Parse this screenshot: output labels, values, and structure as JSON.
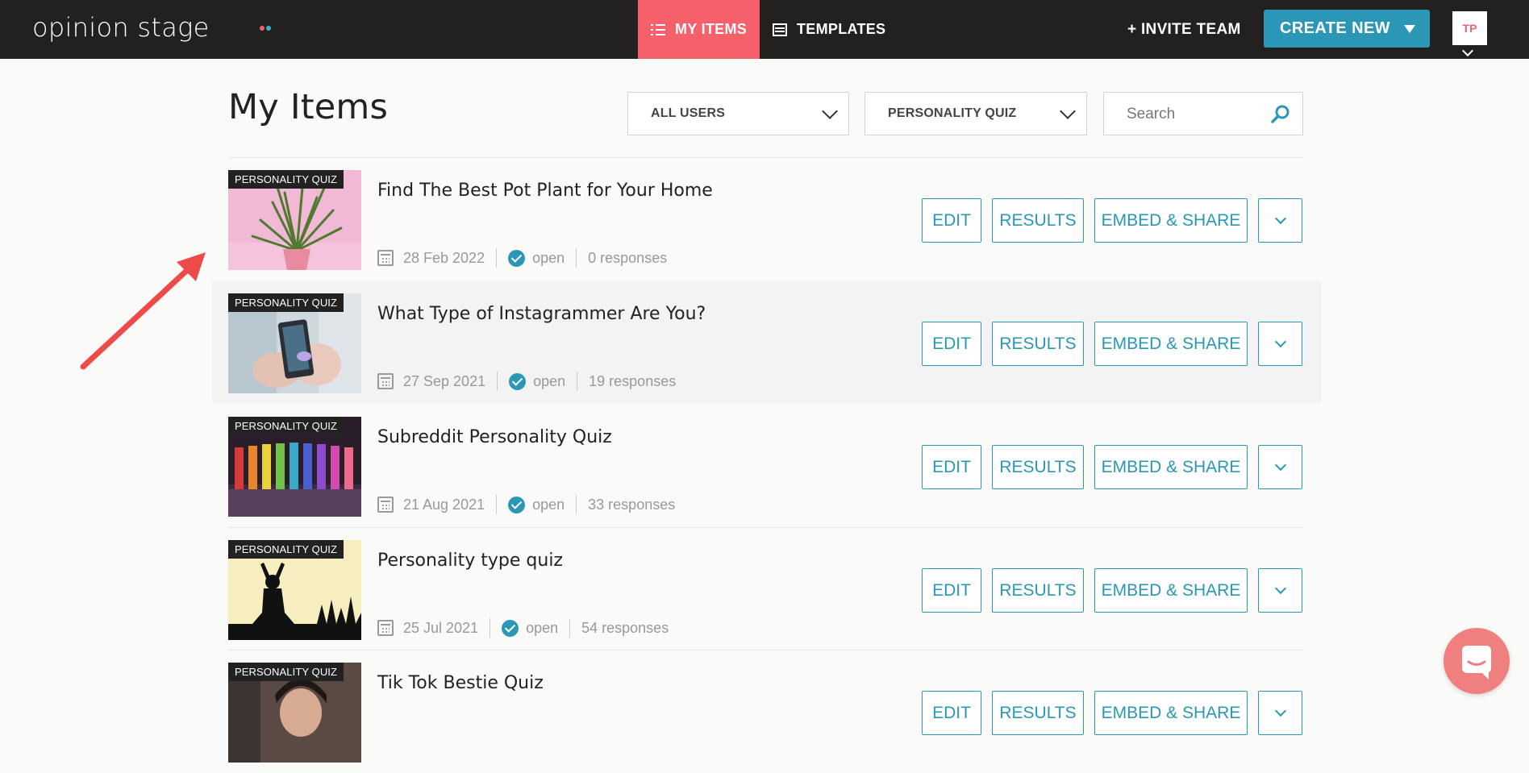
{
  "header": {
    "logo": "opinion stage",
    "tabs": [
      {
        "label": "MY ITEMS",
        "active": true
      },
      {
        "label": "TEMPLATES",
        "active": false
      }
    ],
    "invite_label": "+ INVITE TEAM",
    "create_new_label": "CREATE NEW",
    "avatar_label": "TP"
  },
  "page": {
    "title": "My Items",
    "filters": {
      "users": "ALL USERS",
      "type": "PERSONALITY QUIZ"
    },
    "search": {
      "placeholder": "Search",
      "value": ""
    }
  },
  "buttons": {
    "edit": "EDIT",
    "results": "RESULTS",
    "embed": "EMBED & SHARE"
  },
  "items": [
    {
      "badge": "PERSONALITY QUIZ",
      "title": "Find The Best Pot Plant for Your Home",
      "date": "28 Feb 2022",
      "status": "open",
      "responses": "0 responses"
    },
    {
      "badge": "PERSONALITY QUIZ",
      "title": "What Type of Instagrammer Are You?",
      "date": "27 Sep 2021",
      "status": "open",
      "responses": "19 responses"
    },
    {
      "badge": "PERSONALITY QUIZ",
      "title": "Subreddit Personality Quiz",
      "date": "21 Aug 2021",
      "status": "open",
      "responses": "33 responses"
    },
    {
      "badge": "PERSONALITY QUIZ",
      "title": "Personality type quiz",
      "date": "25 Jul 2021",
      "status": "open",
      "responses": "54 responses"
    },
    {
      "badge": "PERSONALITY QUIZ",
      "title": "Tik Tok Bestie Quiz",
      "date": "",
      "status": "",
      "responses": ""
    }
  ],
  "colors": {
    "topbar": "#222120",
    "accent_coral": "#f5606a",
    "accent_teal": "#2a97b7",
    "annotation_arrow": "#ee4a4a"
  }
}
